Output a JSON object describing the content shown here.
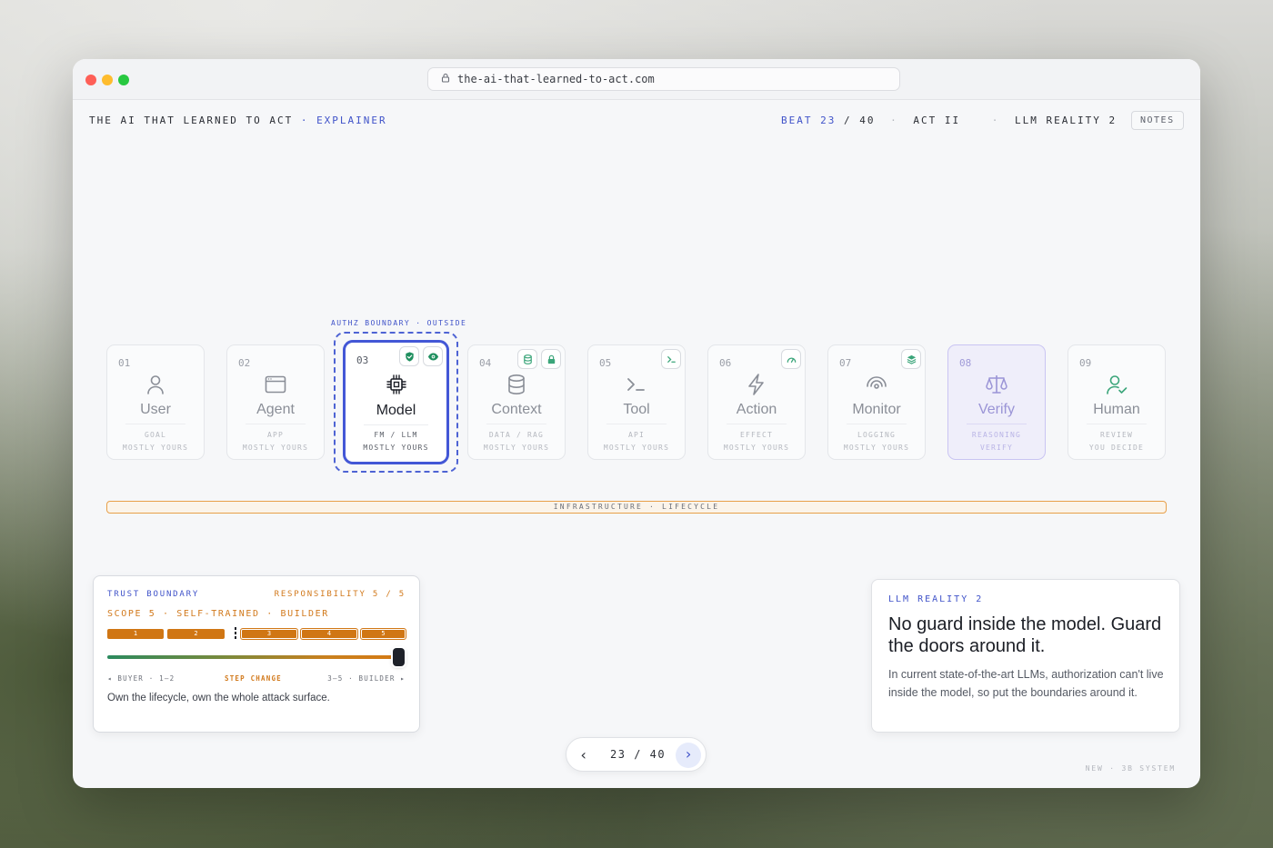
{
  "browser": {
    "url": "the-ai-that-learned-to-act.com"
  },
  "header": {
    "brand": "THE AI THAT LEARNED TO ACT",
    "brand_sep": "·",
    "brand_sub": "EXPLAINER",
    "beat_label": "BEAT",
    "beat_current": "23",
    "beat_sep": "/",
    "beat_total": "40",
    "act": "ACT II",
    "section": "LLM REALITY 2",
    "dot": "·",
    "notes": "NOTES"
  },
  "boundary": {
    "label": "AUTHZ BOUNDARY · OUTSIDE"
  },
  "pipeline": [
    {
      "num": "01",
      "name": "User",
      "sub1": "GOAL",
      "sub2": "MOSTLY YOURS",
      "icon": "user-icon"
    },
    {
      "num": "02",
      "name": "Agent",
      "sub1": "APP",
      "sub2": "MOSTLY YOURS",
      "icon": "browser-window-icon"
    },
    {
      "num": "03",
      "name": "Model",
      "sub1": "FM / LLM",
      "sub2": "MOSTLY YOURS",
      "icon": "cpu-chip-icon",
      "badges": [
        "shield-check-icon",
        "eye-icon"
      ]
    },
    {
      "num": "04",
      "name": "Context",
      "sub1": "DATA / RAG",
      "sub2": "MOSTLY YOURS",
      "icon": "database-icon",
      "badges": [
        "database-icon",
        "lock-icon"
      ]
    },
    {
      "num": "05",
      "name": "Tool",
      "sub1": "API",
      "sub2": "MOSTLY YOURS",
      "icon": "terminal-icon",
      "badges": [
        "terminal-icon"
      ]
    },
    {
      "num": "06",
      "name": "Action",
      "sub1": "EFFECT",
      "sub2": "MOSTLY YOURS",
      "icon": "lightning-icon",
      "badges": [
        "gauge-icon"
      ]
    },
    {
      "num": "07",
      "name": "Monitor",
      "sub1": "LOGGING",
      "sub2": "MOSTLY YOURS",
      "icon": "signal-arc-icon",
      "badges": [
        "layers-icon"
      ]
    },
    {
      "num": "08",
      "name": "Verify",
      "sub1": "REASONING",
      "sub2": "VERIFY",
      "icon": "scale-icon"
    },
    {
      "num": "09",
      "name": "Human",
      "sub1": "REVIEW",
      "sub2": "YOU DECIDE",
      "icon": "user-check-icon"
    }
  ],
  "infrastructure": {
    "label": "INFRASTRUCTURE · LIFECYCLE"
  },
  "trust_panel": {
    "title": "TRUST BOUNDARY",
    "responsibility": "RESPONSIBILITY 5 / 5",
    "scope": "SCOPE 5 · SELF-TRAINED · BUILDER",
    "segments": [
      "1",
      "2",
      "3",
      "4",
      "5"
    ],
    "slider_value": 1.0,
    "scale_left": "◂ BUYER · 1–2",
    "scale_mid": "STEP CHANGE",
    "scale_right": "3–5 · BUILDER ▸",
    "description": "Own the lifecycle, own the whole attack surface."
  },
  "reality_panel": {
    "label": "LLM REALITY 2",
    "heading": "No guard inside the model. Guard the doors around it.",
    "body": "In current state-of-the-art LLMs, authorization can't live inside the model, so put the boundaries around it."
  },
  "pager": {
    "prev": "‹",
    "current": "23",
    "sep": "/",
    "total": "40",
    "next": "›"
  },
  "footer": {
    "note": "NEW · 3B SYSTEM"
  },
  "colors": {
    "accent": "#4053c9",
    "orange": "#d07614",
    "green": "#2b8a5e",
    "verify": "#9a94d6"
  }
}
